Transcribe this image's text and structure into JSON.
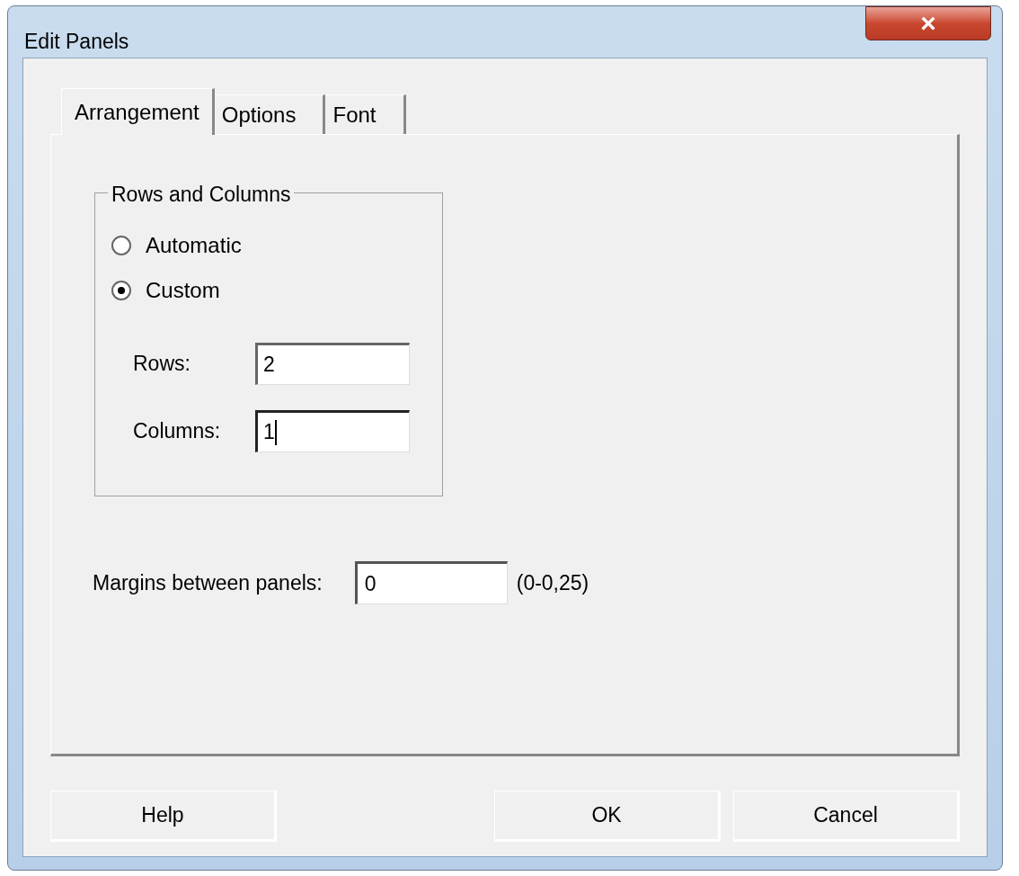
{
  "window": {
    "title": "Edit Panels",
    "close": "×"
  },
  "tabs": [
    {
      "label": "Arrangement",
      "selected": true
    },
    {
      "label": "Options",
      "selected": false
    },
    {
      "label": "Font",
      "selected": false
    }
  ],
  "group": {
    "title": "Rows and Columns",
    "radios": [
      {
        "label": "Automatic",
        "selected": false
      },
      {
        "label": "Custom",
        "selected": true
      }
    ],
    "fields": [
      {
        "label": "Rows:",
        "value": "2",
        "focused": false
      },
      {
        "label": "Columns:",
        "value": "1",
        "focused": true
      }
    ]
  },
  "margins": {
    "label": "Margins between panels:",
    "value": "0",
    "range": "(0-0,25)"
  },
  "buttons": [
    {
      "label": "Help"
    },
    {
      "label": "OK"
    },
    {
      "label": "Cancel"
    }
  ]
}
